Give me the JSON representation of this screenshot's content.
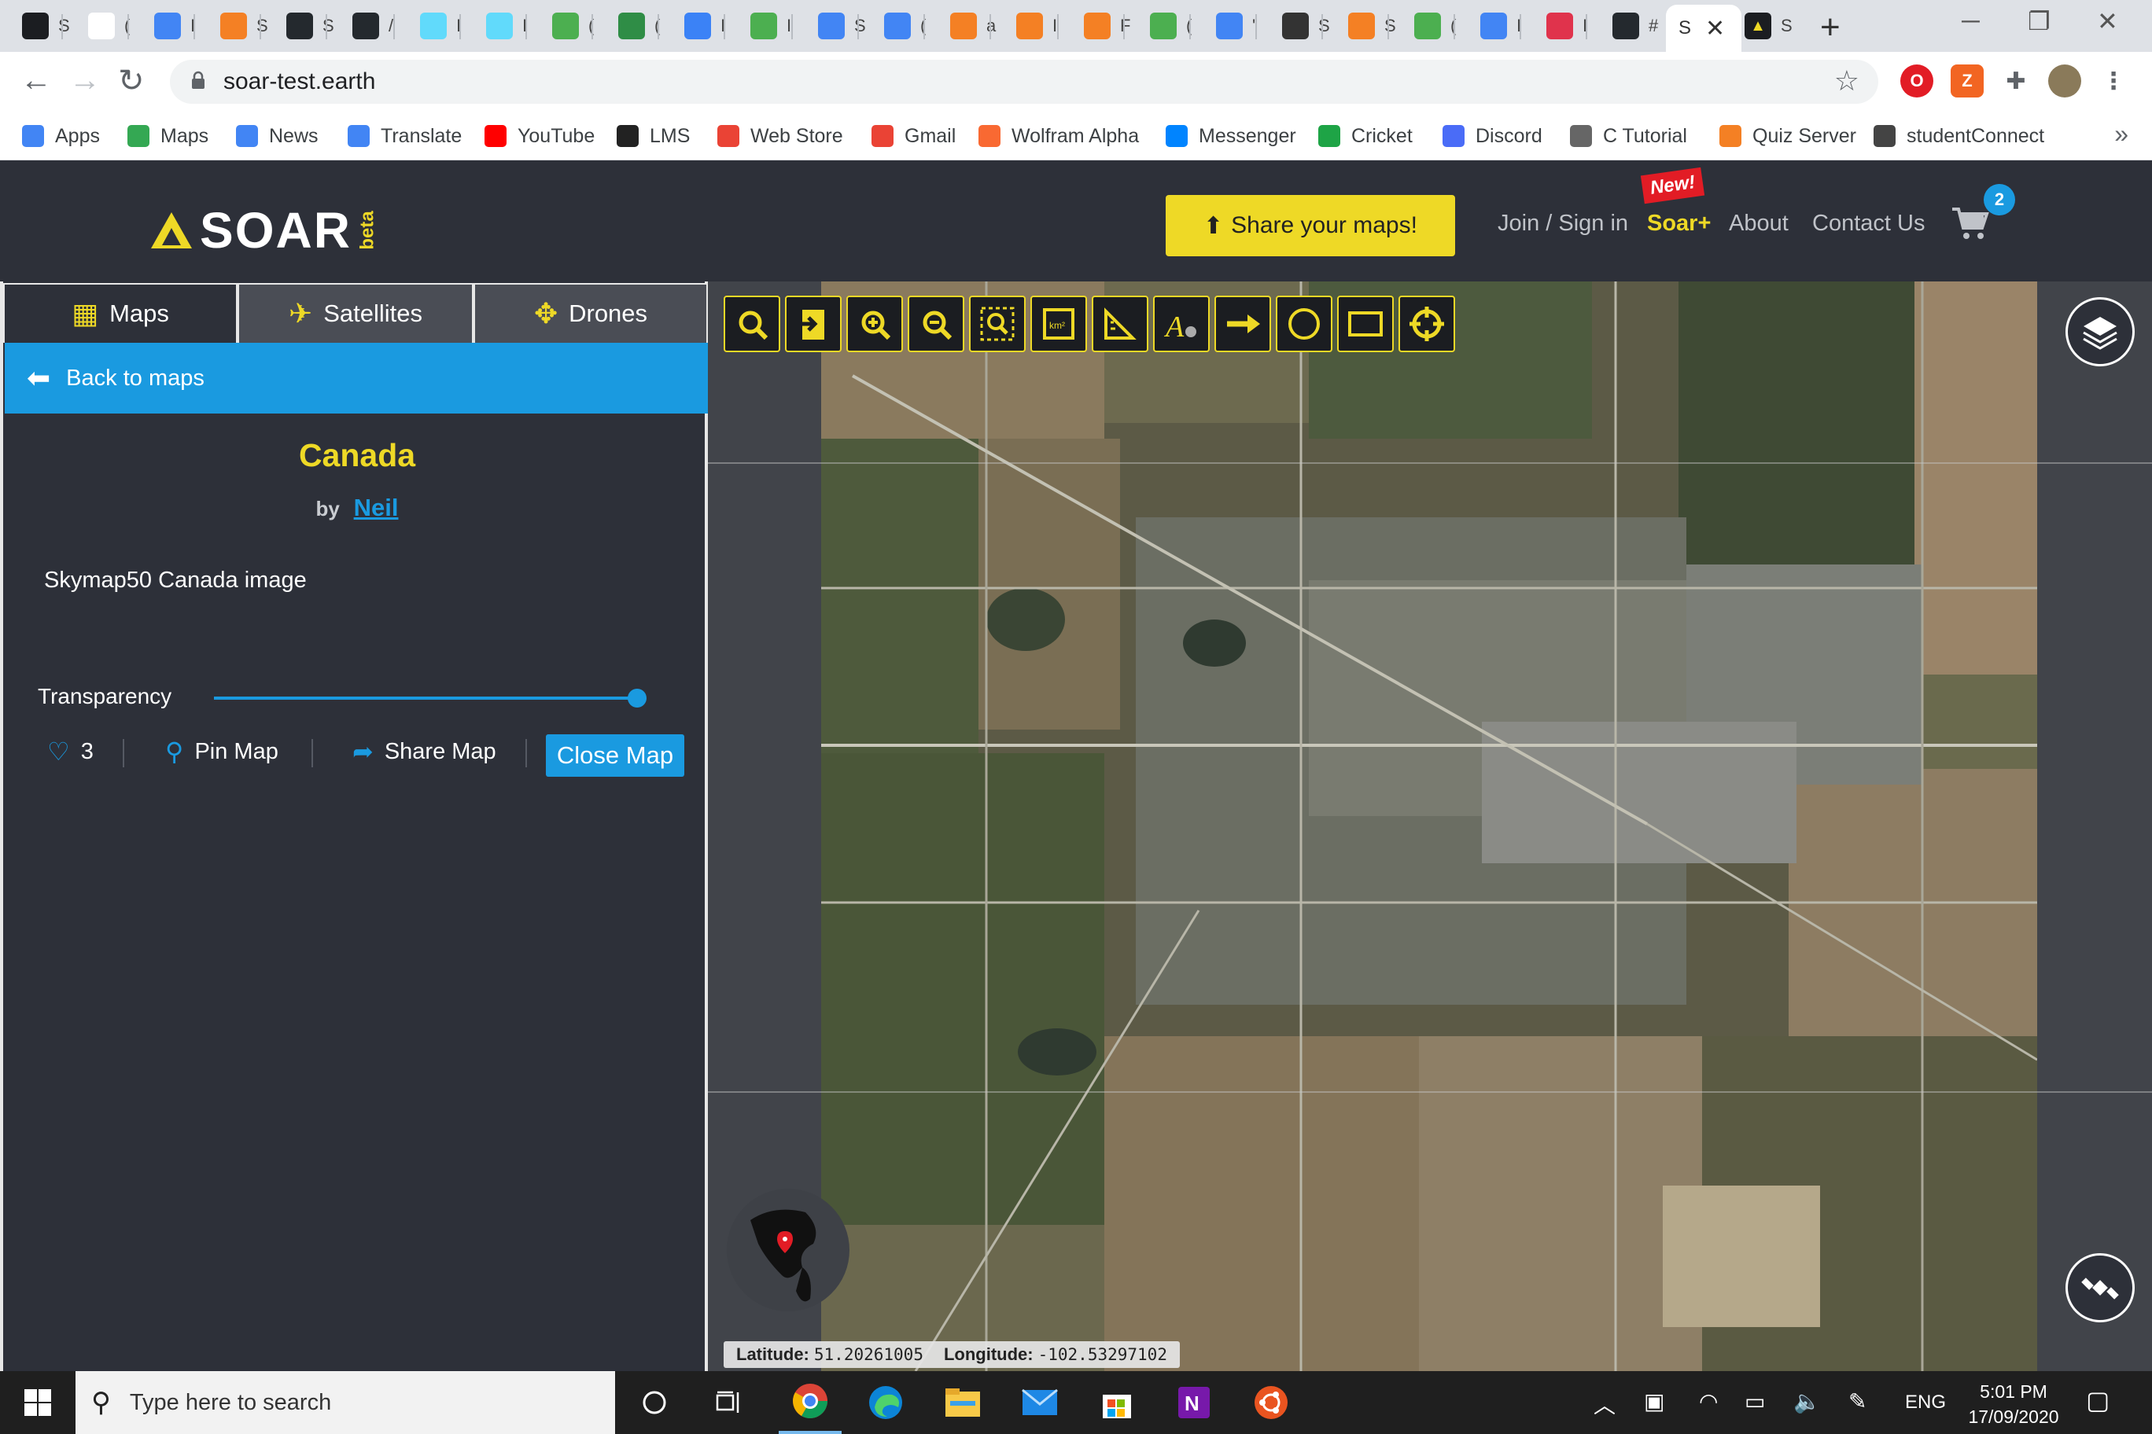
{
  "browser": {
    "tabs": [
      {
        "icon": "soar-favicon",
        "label": "S",
        "color": "#1b1d21"
      },
      {
        "icon": "code-favicon",
        "label": "(",
        "color": "#ffffff"
      },
      {
        "icon": "drive-favicon",
        "label": "I",
        "color": "#4285f4"
      },
      {
        "icon": "stackoverflow-favicon",
        "label": "S",
        "color": "#f48024"
      },
      {
        "icon": "github-favicon",
        "label": "S",
        "color": "#24292e"
      },
      {
        "icon": "github-favicon",
        "label": "/",
        "color": "#24292e"
      },
      {
        "icon": "react-favicon",
        "label": "I",
        "color": "#61dafb"
      },
      {
        "icon": "react-favicon",
        "label": "I",
        "color": "#61dafb"
      },
      {
        "icon": "w3schools-favicon",
        "label": "(",
        "color": "#4caf50"
      },
      {
        "icon": "geeksforgeeks-favicon",
        "label": "(",
        "color": "#2f8d46"
      },
      {
        "icon": "cloud-favicon",
        "label": "I",
        "color": "#3b82f6"
      },
      {
        "icon": "w3schools-favicon",
        "label": "I",
        "color": "#4caf50"
      },
      {
        "icon": "google-favicon",
        "label": "S",
        "color": "#4285f4"
      },
      {
        "icon": "google-favicon",
        "label": "(",
        "color": "#4285f4"
      },
      {
        "icon": "stackoverflow-favicon",
        "label": "a",
        "color": "#f48024"
      },
      {
        "icon": "stackoverflow-favicon",
        "label": "I",
        "color": "#f48024"
      },
      {
        "icon": "stackoverflow-favicon",
        "label": "F",
        "color": "#f48024"
      },
      {
        "icon": "w3schools-favicon",
        "label": "(",
        "color": "#4caf50"
      },
      {
        "icon": "google-favicon",
        "label": "'",
        "color": "#4285f4"
      },
      {
        "icon": "globe-favicon",
        "label": "S",
        "color": "#333333"
      },
      {
        "icon": "stackoverflow-favicon",
        "label": "S",
        "color": "#f48024"
      },
      {
        "icon": "w3schools-favicon",
        "label": "(",
        "color": "#4caf50"
      },
      {
        "icon": "google-favicon",
        "label": "I",
        "color": "#4285f4"
      },
      {
        "icon": "pin-favicon",
        "label": "I",
        "color": "#e0334c"
      },
      {
        "icon": "github-favicon",
        "label": "#",
        "color": "#24292e"
      }
    ],
    "active_tab": {
      "label": "S",
      "close": "✕"
    },
    "after_tab": {
      "icon": "soar-favicon",
      "label": "S"
    },
    "new_tab": "+",
    "window_controls": {
      "minimize": "─",
      "restore": "❐",
      "close": "✕"
    },
    "url": "soar-test.earth",
    "bookmarks": [
      {
        "icon": "apps-icon",
        "label": "Apps",
        "color": "#4285f4"
      },
      {
        "icon": "maps-icon",
        "label": "Maps",
        "color": "#34a853"
      },
      {
        "icon": "news-icon",
        "label": "News",
        "color": "#4285f4"
      },
      {
        "icon": "translate-icon",
        "label": "Translate",
        "color": "#4285f4"
      },
      {
        "icon": "youtube-icon",
        "label": "YouTube",
        "color": "#ff0000"
      },
      {
        "icon": "lms-icon",
        "label": "LMS",
        "color": "#222222"
      },
      {
        "icon": "webstore-icon",
        "label": "Web Store",
        "color": "#ea4335"
      },
      {
        "icon": "gmail-icon",
        "label": "Gmail",
        "color": "#ea4335"
      },
      {
        "icon": "wolfram-icon",
        "label": "Wolfram Alpha",
        "color": "#f96932"
      },
      {
        "icon": "messenger-icon",
        "label": "Messenger",
        "color": "#0084ff"
      },
      {
        "icon": "cricket-icon",
        "label": "Cricket",
        "color": "#1ea446"
      },
      {
        "icon": "discord-icon",
        "label": "Discord",
        "color": "#4a6cf7"
      },
      {
        "icon": "ctutorial-icon",
        "label": "C Tutorial",
        "color": "#666666"
      },
      {
        "icon": "quiz-icon",
        "label": "Quiz Server",
        "color": "#f48024"
      },
      {
        "icon": "studentconnect-icon",
        "label": "studentConnect",
        "color": "#444444"
      }
    ],
    "bookmarks_more": "»"
  },
  "header": {
    "logo_text": "SOAR",
    "logo_beta": "beta",
    "share_button": "Share your maps!",
    "nav": [
      "Join / Sign in",
      "Soar+",
      "About",
      "Contact Us"
    ],
    "new_badge": "New!",
    "cart_count": "2",
    "accent_color": "#eed926"
  },
  "sidebar": {
    "tabs": [
      {
        "icon": "maps-icon",
        "label": "Maps"
      },
      {
        "icon": "satellite-icon",
        "label": "Satellites"
      },
      {
        "icon": "drone-icon",
        "label": "Drones"
      }
    ],
    "back_label": "Back to maps",
    "map_title": "Canada",
    "by_label": "by",
    "author": "Neil",
    "description": "Skymap50 Canada image",
    "transparency_label": "Transparency",
    "transparency_value": 1.0,
    "likes": "3",
    "pin_label": "Pin Map",
    "share_label": "Share Map",
    "close_label": "Close Map"
  },
  "map": {
    "tools": [
      "search-icon",
      "import-icon",
      "zoom-in-icon",
      "zoom-out-icon",
      "zoom-area-icon",
      "area-measure-icon",
      "ruler-icon",
      "text-annotate-icon",
      "arrow-icon",
      "circle-icon",
      "rectangle-icon",
      "crosshair-icon"
    ],
    "latitude_label": "Latitude:",
    "latitude": "51.20261005",
    "longitude_label": "Longitude:",
    "longitude": "-102.53297102"
  },
  "taskbar": {
    "search_placeholder": "Type here to search",
    "language": "ENG",
    "time": "5:01 PM",
    "date": "17/09/2020"
  }
}
